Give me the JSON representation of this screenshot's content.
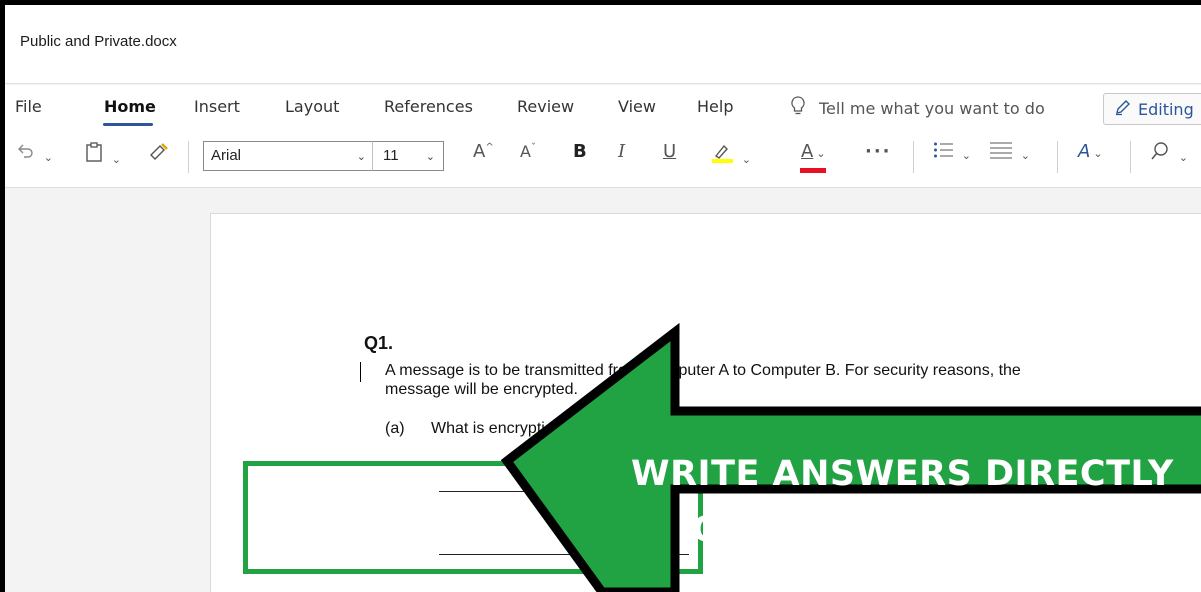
{
  "window": {
    "doc_title": "Public and Private.docx"
  },
  "ribbon": {
    "tabs": [
      {
        "label": "File"
      },
      {
        "label": "Home"
      },
      {
        "label": "Insert"
      },
      {
        "label": "Layout"
      },
      {
        "label": "References"
      },
      {
        "label": "Review"
      },
      {
        "label": "View"
      },
      {
        "label": "Help"
      }
    ],
    "active_tab": "Home",
    "tell_me_placeholder": "Tell me what you want to do",
    "editing_label": "Editing",
    "font_name": "Arial",
    "font_size": "11",
    "more_label": "···",
    "icons": [
      "undo-icon",
      "clipboard-icon",
      "format-painter-icon",
      "grow-font-icon",
      "shrink-font-icon",
      "bold-icon",
      "italic-icon",
      "underline-icon",
      "highlight-icon",
      "font-color-icon",
      "bullets-icon",
      "align-icon",
      "styles-icon",
      "search-icon"
    ],
    "colors": {
      "accent": "#2b579a",
      "highlight": "#ffff00",
      "font_color": "#e81123"
    }
  },
  "document": {
    "question_label": "Q1.",
    "line1": "A message is to be transmitted from Computer A to Computer B. For security reasons, the",
    "line2": "message will be encrypted.",
    "part_a_label": "(a)",
    "part_a_text": "What is encryption?"
  },
  "overlay": {
    "line1": "WRITE ANSWERS DIRECTLY",
    "line2": "ONTO THE DOCUMENT",
    "colors": {
      "arrow": "#21a243",
      "outline": "#000000",
      "answer_box": "#21a243"
    }
  }
}
